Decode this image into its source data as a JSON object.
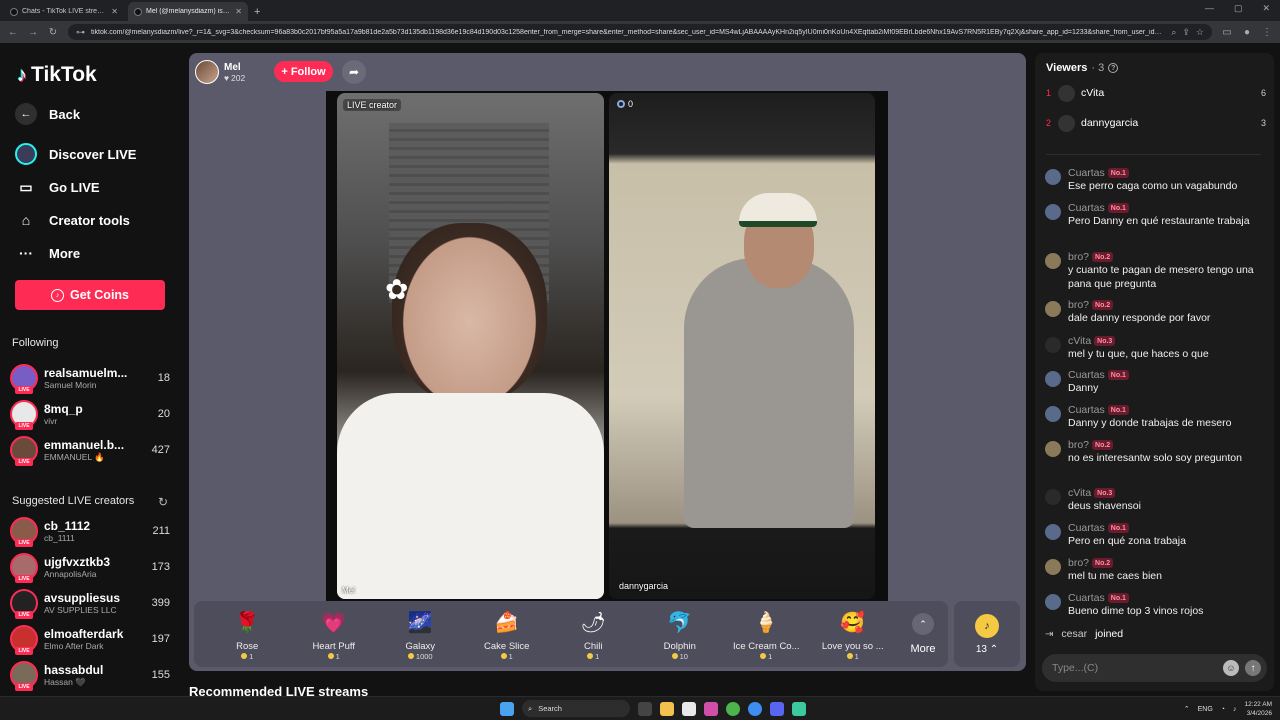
{
  "browser": {
    "tabs": [
      {
        "title": "Chats - TikTok LIVE streams",
        "active": false
      },
      {
        "title": "Mel (@melanysdiazm) is LIVE",
        "active": true
      }
    ],
    "url": "tiktok.com/@melanysdiazm/live?_r=1&_svg=3&checksum=96a83b0c2017bf95a5a17a9b81de2a5b73d135db1198d36e19c84d190d03c1258enter_from_merge=share&enter_method=share&sec_user_id=MS4wLjABAAAAyKHn2iq5yIU0mi0nKoUn4XEqttab2iMf09EBrLbde6Nhx19AvS7RN5R1EBy7q2Xj&share_app_id=1233&share_from_user_id=6644634315..."
  },
  "sidebar": {
    "logo_text": "TikTok",
    "nav": [
      {
        "label": "Back",
        "icon": "arrow-left-icon"
      },
      {
        "label": "Discover LIVE",
        "icon": "discover-live-icon"
      },
      {
        "label": "Go LIVE",
        "icon": "video-camera-icon"
      },
      {
        "label": "Creator tools",
        "icon": "creator-tools-icon"
      },
      {
        "label": "More",
        "icon": "more-dots-icon"
      }
    ],
    "get_coins": "Get Coins",
    "following_title": "Following",
    "following": [
      {
        "user": "realsamuelm...",
        "nick": "Samuel Morin",
        "count": "18",
        "color": "#7a5cc7"
      },
      {
        "user": "8mq_p",
        "nick": "vivr",
        "count": "20",
        "color": "#e8e8e8"
      },
      {
        "user": "emmanuel.b...",
        "nick": "EMMANUEL 🔥",
        "count": "427",
        "color": "#6b4a3c"
      }
    ],
    "suggested_title": "Suggested LIVE creators",
    "suggested": [
      {
        "user": "cb_1112",
        "nick": "cb_1111",
        "count": "211",
        "color": "#8a5b4a"
      },
      {
        "user": "ujgfvxztkb3",
        "nick": "AnnapolisAria",
        "count": "173",
        "color": "#a86b6b"
      },
      {
        "user": "avsuppliesus",
        "nick": "AV SUPPLIES LLC",
        "count": "399",
        "color": "#222222"
      },
      {
        "user": "elmoafterdark",
        "nick": "Elmo After Dark",
        "count": "197",
        "color": "#c8302e"
      },
      {
        "user": "hassabdul",
        "nick": "Hassan 🖤",
        "count": "155",
        "color": "#7a6a5a"
      }
    ],
    "live_badge": "LIVE"
  },
  "stage": {
    "host_name": "Mel",
    "host_likes": "202",
    "follow_label": "+ Follow",
    "live_creator_label": "LIVE creator",
    "left_name": "Mel",
    "right_score": "0",
    "right_name": "dannygarcia",
    "gifts": [
      {
        "name": "Rose",
        "price": "1",
        "icon": "🌹",
        "color": "#3a3a48"
      },
      {
        "name": "Heart Puff",
        "price": "1",
        "icon": "💗",
        "color": "#3a3a48"
      },
      {
        "name": "Galaxy",
        "price": "1000",
        "icon": "🌌",
        "color": "#3a3a48"
      },
      {
        "name": "Cake Slice",
        "price": "1",
        "icon": "🍰",
        "color": "#3a3a48"
      },
      {
        "name": "Chili",
        "price": "1",
        "icon": "🌶",
        "color": "#3a3a48"
      },
      {
        "name": "Dolphin",
        "price": "10",
        "icon": "🐬",
        "color": "#3a3a48"
      },
      {
        "name": "Ice Cream Co...",
        "price": "1",
        "icon": "🍦",
        "color": "#3a3a48"
      },
      {
        "name": "Love you so ...",
        "price": "1",
        "icon": "🥰",
        "color": "#3a3a48"
      }
    ],
    "more_label": "More",
    "coin_count": "13",
    "recommended_title": "Recommended LIVE streams"
  },
  "chat": {
    "viewers_title": "Viewers",
    "viewers_count": "· 3",
    "top_viewers": [
      {
        "rank": "1",
        "name": "cVita",
        "score": "6"
      },
      {
        "rank": "2",
        "name": "dannygarcia",
        "score": "3"
      }
    ],
    "messages": [
      {
        "user": "Cuartas",
        "badge": "No.1",
        "text": "Ese perro caga como un vagabundo",
        "color": "#5a6a8a"
      },
      {
        "user": "Cuartas",
        "badge": "No.1",
        "text": "Pero Danny en qué restaurante trabaja",
        "color": "#5a6a8a"
      },
      {
        "user": "bro?",
        "badge": "No.2",
        "text": "y cuanto te pagan de mesero tengo una pana que pregunta",
        "color": "#8a7a5a"
      },
      {
        "user": "bro?",
        "badge": "No.2",
        "text": "dale danny responde por favor",
        "color": "#8a7a5a"
      },
      {
        "user": "cVita",
        "badge": "No.3",
        "text": "mel y tu que, que haces o que",
        "color": "#2a2a2a"
      },
      {
        "user": "Cuartas",
        "badge": "No.1",
        "text": "Danny",
        "color": "#5a6a8a"
      },
      {
        "user": "Cuartas",
        "badge": "No.1",
        "text": "Danny y donde trabajas de mesero",
        "color": "#5a6a8a"
      },
      {
        "user": "bro?",
        "badge": "No.2",
        "text": "no es interesantw solo soy pregunton",
        "color": "#8a7a5a"
      },
      {
        "user": "cVita",
        "badge": "No.3",
        "text": "deus shavensoi",
        "color": "#2a2a2a"
      },
      {
        "user": "Cuartas",
        "badge": "No.1",
        "text": "Pero en qué zona trabaja",
        "color": "#5a6a8a"
      },
      {
        "user": "bro?",
        "badge": "No.2",
        "text": "mel tu me caes bien",
        "color": "#8a7a5a"
      },
      {
        "user": "Cuartas",
        "badge": "No.1",
        "text": "Bueno dime top 3 vinos rojos",
        "color": "#5a6a8a"
      }
    ],
    "joined_user": "cesar",
    "joined_text": "joined",
    "input_placeholder": "Type...(C)"
  },
  "taskbar": {
    "search_label": "Search",
    "lang": "ENG",
    "time": "12:22 AM",
    "date": "3/4/2026"
  },
  "colors": {
    "accent": "#fe2c55",
    "coin": "#f6c945"
  }
}
